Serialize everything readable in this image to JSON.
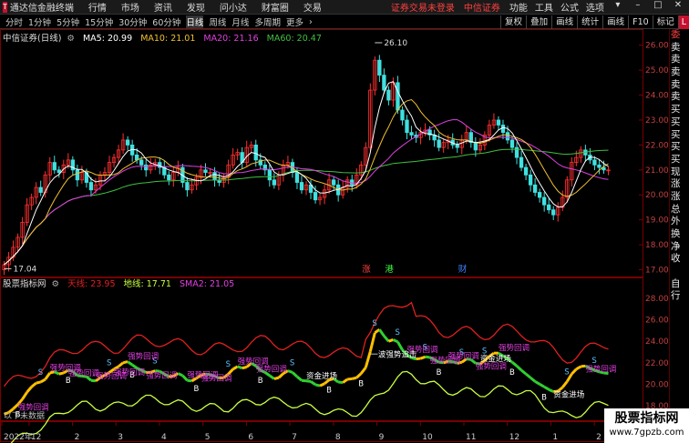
{
  "menubar": {
    "app_title": "通达信金融终端",
    "items": [
      "行情",
      "市场",
      "资讯",
      "发现",
      "问小达",
      "财富圈",
      "交易"
    ],
    "alert": "证券交易未登录",
    "broker": "中信证券",
    "right_items": [
      "功能",
      "工具",
      "公式",
      "选项"
    ],
    "user": "游客"
  },
  "periods": [
    "分时",
    "1分钟",
    "5分钟",
    "15分钟",
    "30分钟",
    "60分钟",
    "日线",
    "周线",
    "月线",
    "多周期",
    "更多"
  ],
  "active_period": "日线",
  "more_arrow": "›",
  "tools": [
    "复权",
    "叠加",
    "画线",
    "统计",
    "画线",
    "F10",
    "标记"
  ],
  "extra_button": "L",
  "price_legend": {
    "name": "中信证券(日线)",
    "ma5": "MA5: 20.99",
    "ma10": "MA10: 21.01",
    "ma20": "MA20: 21.16",
    "ma60": "MA60: 20.47"
  },
  "indicator_legend": {
    "name": "股票指标网",
    "sky": "天线: 23.95",
    "ground": "地线: 17.71",
    "sma": "SMA2: 21.05"
  },
  "colors": {
    "ma5": "#ffffff",
    "ma10": "#f0c030",
    "ma20": "#e040e0",
    "ma60": "#40c040",
    "sky": "#e02020",
    "ground": "#c8ff40",
    "up": "#ff3030",
    "down": "#40e0e0",
    "sma_up": "#ffc000",
    "sma_down": "#30d030"
  },
  "chart_data": [
    {
      "type": "candlestick",
      "title": "中信证券(日线)",
      "ylim": [
        16.8,
        26.5
      ],
      "yticks": [
        "26.00",
        "25.00",
        "24.00",
        "23.00",
        "22.00",
        "21.00",
        "20.00",
        "19.00",
        "18.00",
        "17.00"
      ],
      "annotations": [
        {
          "label": "26.10",
          "value": 26.1
        },
        {
          "label": "17.04",
          "value": 17.04
        }
      ],
      "event_markers": [
        "涨",
        "港",
        "财"
      ],
      "closes": [
        17.2,
        17.5,
        17.9,
        18.3,
        18.9,
        19.6,
        19.9,
        20.3,
        20.1,
        20.8,
        21.3,
        21.0,
        20.9,
        21.2,
        21.4,
        21.0,
        20.6,
        20.9,
        20.5,
        20.2,
        20.4,
        20.8,
        20.9,
        21.3,
        21.5,
        21.8,
        22.2,
        22.0,
        21.6,
        21.4,
        21.2,
        21.0,
        21.2,
        21.3,
        21.1,
        20.8,
        20.6,
        20.9,
        21.1,
        20.5,
        20.2,
        20.4,
        20.7,
        21.0,
        20.9,
        20.9,
        20.6,
        20.5,
        20.7,
        21.2,
        21.6,
        21.7,
        21.3,
        21.9,
        22.0,
        21.4,
        21.2,
        21.0,
        20.6,
        20.4,
        20.8,
        21.2,
        21.3,
        20.9,
        20.5,
        20.2,
        20.4,
        20.1,
        19.8,
        19.9,
        20.2,
        20.6,
        20.4,
        20.0,
        20.3,
        20.6,
        20.4,
        20.8,
        21.2,
        21.9,
        24.2,
        25.4,
        24.8,
        24.2,
        23.8,
        24.5,
        23.4,
        23.0,
        22.5,
        22.4,
        22.3,
        22.5,
        22.6,
        22.4,
        22.2,
        21.9,
        22.1,
        22.2,
        22.0,
        21.9,
        22.2,
        22.5,
        22.1,
        21.8,
        22.0,
        22.4,
        22.8,
        23.0,
        22.8,
        22.5,
        22.2,
        21.9,
        21.5,
        21.1,
        20.8,
        20.4,
        20.1,
        19.9,
        19.6,
        19.4,
        19.2,
        19.5,
        19.9,
        20.6,
        21.3,
        21.5,
        21.8,
        21.6,
        21.4,
        21.2,
        21.1,
        21.0,
        21.0
      ],
      "series": [
        {
          "name": "MA5",
          "last": 20.99
        },
        {
          "name": "MA10",
          "last": 21.01
        },
        {
          "name": "MA20",
          "last": 21.16
        },
        {
          "name": "MA60",
          "last": 20.47
        }
      ]
    },
    {
      "type": "line",
      "title": "股票指标网",
      "ylim": [
        16.8,
        29.2
      ],
      "yticks": [
        "28.00",
        "26.00",
        "24.00",
        "22.00",
        "20.00",
        "18.00"
      ],
      "series": [
        {
          "name": "天线",
          "last": 23.95
        },
        {
          "name": "地线",
          "last": 17.71
        },
        {
          "name": "SMA2",
          "last": 21.05
        }
      ],
      "text_labels": [
        "强势回调",
        "强势回调",
        "强势回调",
        "强势回调",
        "强势回调",
        "强势回调",
        "强势回调",
        "强势回调",
        "强势回调",
        "强势回调",
        "强势回调",
        "强势回调",
        "强势回调",
        "强势回调",
        "强势回调",
        "强势回调",
        "强势回调",
        "资金进场",
        "一波强势追击",
        "资金进场",
        "资金进场"
      ],
      "signal_marks": [
        "S",
        "B"
      ],
      "status_text": "以下未数据"
    }
  ],
  "x_axis": {
    "labels": [
      "2022年",
      "12",
      "2",
      "3",
      "4",
      "5",
      "6",
      "7",
      "8",
      "9",
      "10",
      "11",
      "12",
      "1",
      "2"
    ]
  },
  "side_panel": {
    "items": [
      "委比",
      "卖五",
      "卖四",
      "卖三",
      "卖二",
      "卖一",
      "买一",
      "买二",
      "买三",
      "买四",
      "买五",
      "现价",
      "涨跌",
      "涨幅",
      "总量",
      "外盘",
      "换手",
      "净资",
      "收益",
      "",
      "自动",
      "行情"
    ]
  },
  "brand": {
    "title": "股票指标网",
    "url": "www.7gpzb.com"
  }
}
